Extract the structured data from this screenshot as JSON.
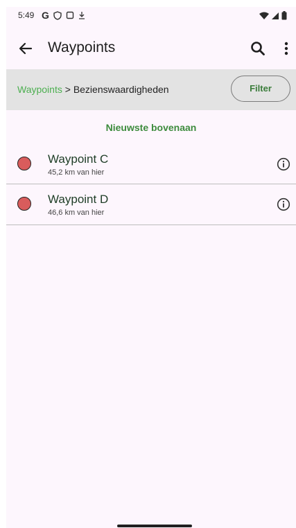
{
  "status_bar": {
    "time": "5:49",
    "google_letter": "G",
    "icons": [
      "google-icon",
      "shield-icon",
      "screen-icon",
      "download-icon",
      "wifi-icon",
      "signal-icon",
      "battery-icon"
    ]
  },
  "app_bar": {
    "title": "Waypoints",
    "icons": [
      "arrow-back-icon",
      "search-icon",
      "more-vert-icon"
    ]
  },
  "breadcrumb": {
    "root": "Waypoints",
    "separator": " > ",
    "current": "Bezienswaardigheden"
  },
  "filter_button": {
    "label": "Filter"
  },
  "sort": {
    "label": "Nieuwste bovenaan"
  },
  "waypoints": [
    {
      "name": "Waypoint C",
      "distance": "45,2 km van hier",
      "icon": "info-icon"
    },
    {
      "name": "Waypoint D",
      "distance": "46,6 km van hier",
      "icon": "info-icon"
    }
  ],
  "colors": {
    "accent_green": "#4caf50",
    "marker_red": "#d95c5c",
    "background": "#fdf6fd",
    "breadcrumb_bg": "#e3e3e3"
  }
}
